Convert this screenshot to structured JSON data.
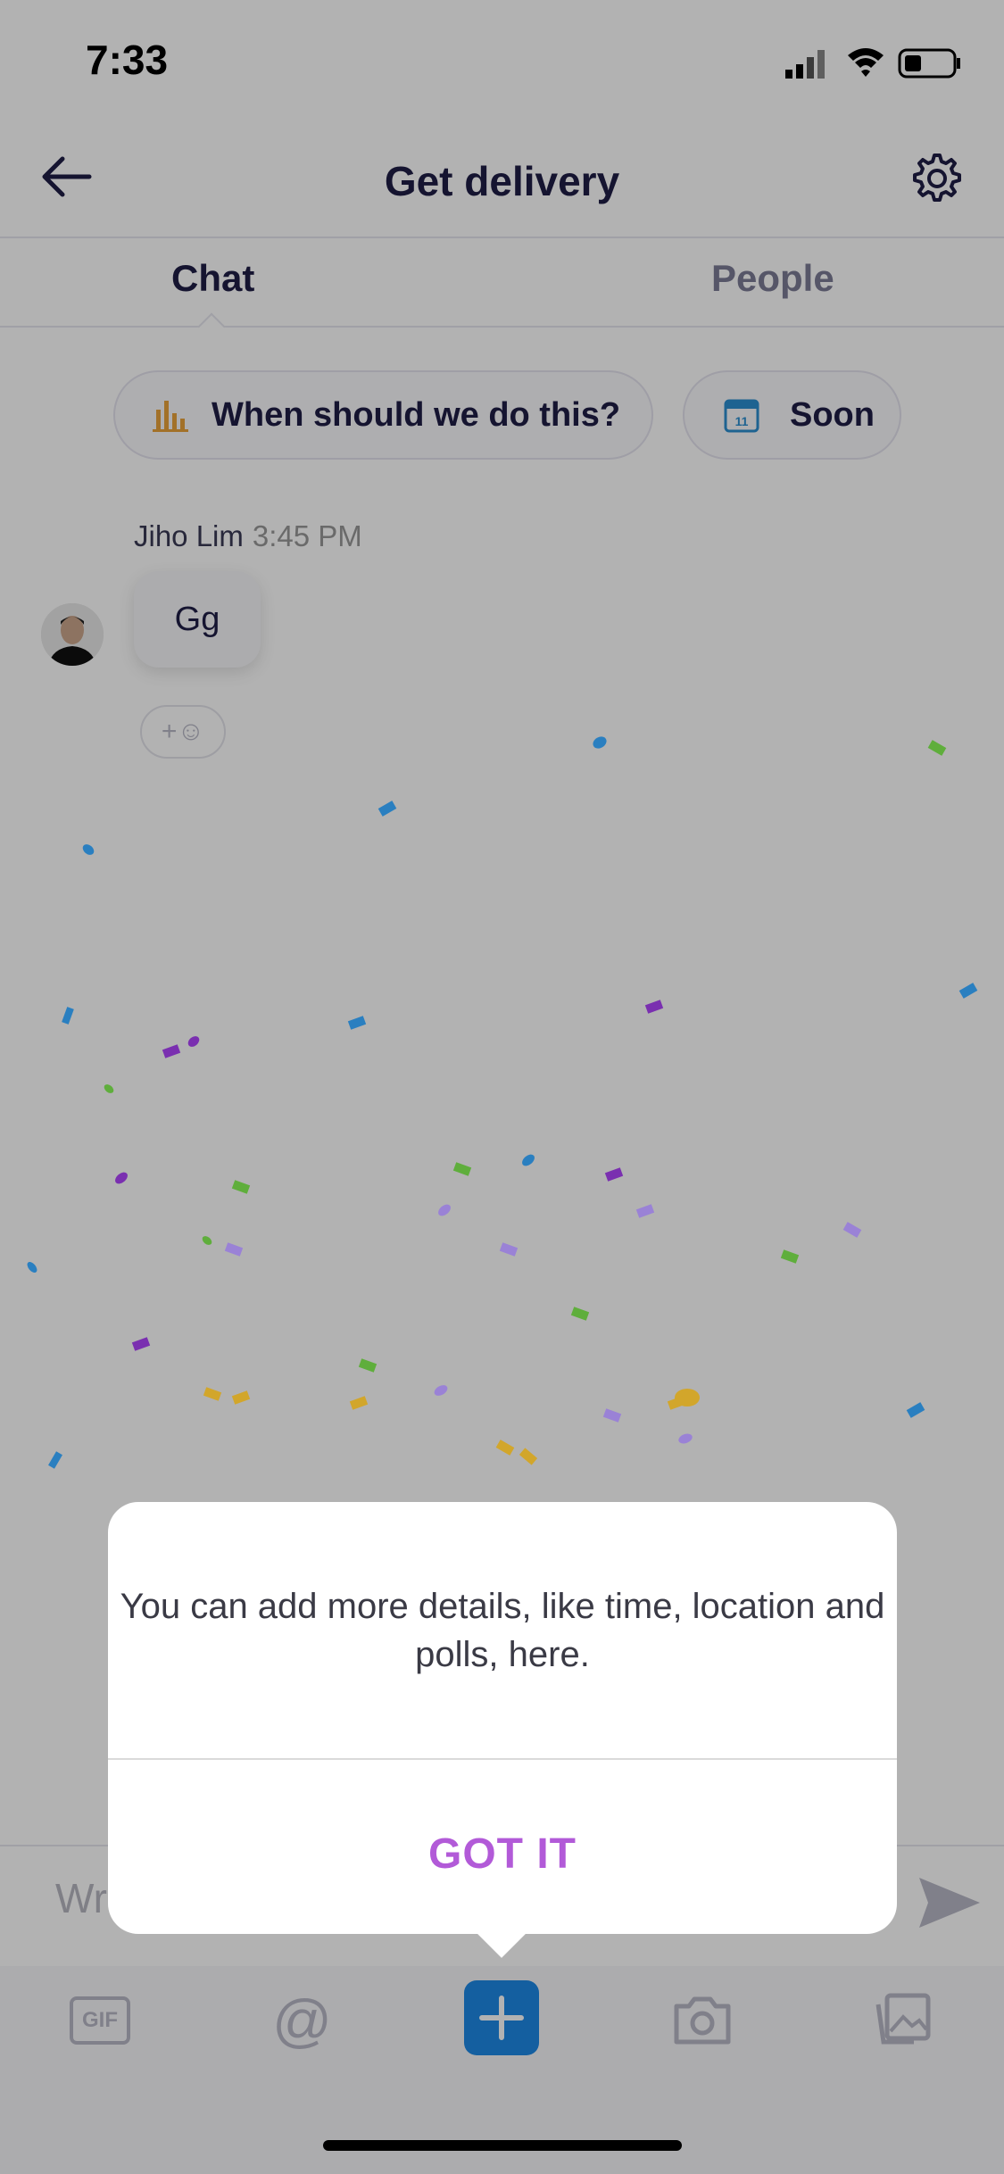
{
  "status_bar": {
    "time": "7:33"
  },
  "header": {
    "title": "Get delivery",
    "back_icon": "arrow-left-icon",
    "settings_icon": "gear-icon"
  },
  "tabs": [
    {
      "label": "Chat",
      "active": true
    },
    {
      "label": "People",
      "active": false
    }
  ],
  "chips": [
    {
      "label": "When should we do this?",
      "icon": "bar-chart-icon",
      "icon_color": "#e8a23b"
    },
    {
      "label": "Soon",
      "icon": "calendar-icon",
      "icon_color": "#2b8fd0",
      "icon_text": "11"
    }
  ],
  "message": {
    "sender": "Jiho Lim",
    "time": "3:45 PM",
    "text": "Gg",
    "reaction_label": "+☺"
  },
  "composer": {
    "placeholder": "Wr"
  },
  "toolbar": {
    "gif_label": "GIF",
    "mention_label": "@"
  },
  "dialog": {
    "message": "You can add more details, like time, location and polls, here.",
    "button_label": "GOT IT",
    "button_color": "#b25ad8"
  }
}
